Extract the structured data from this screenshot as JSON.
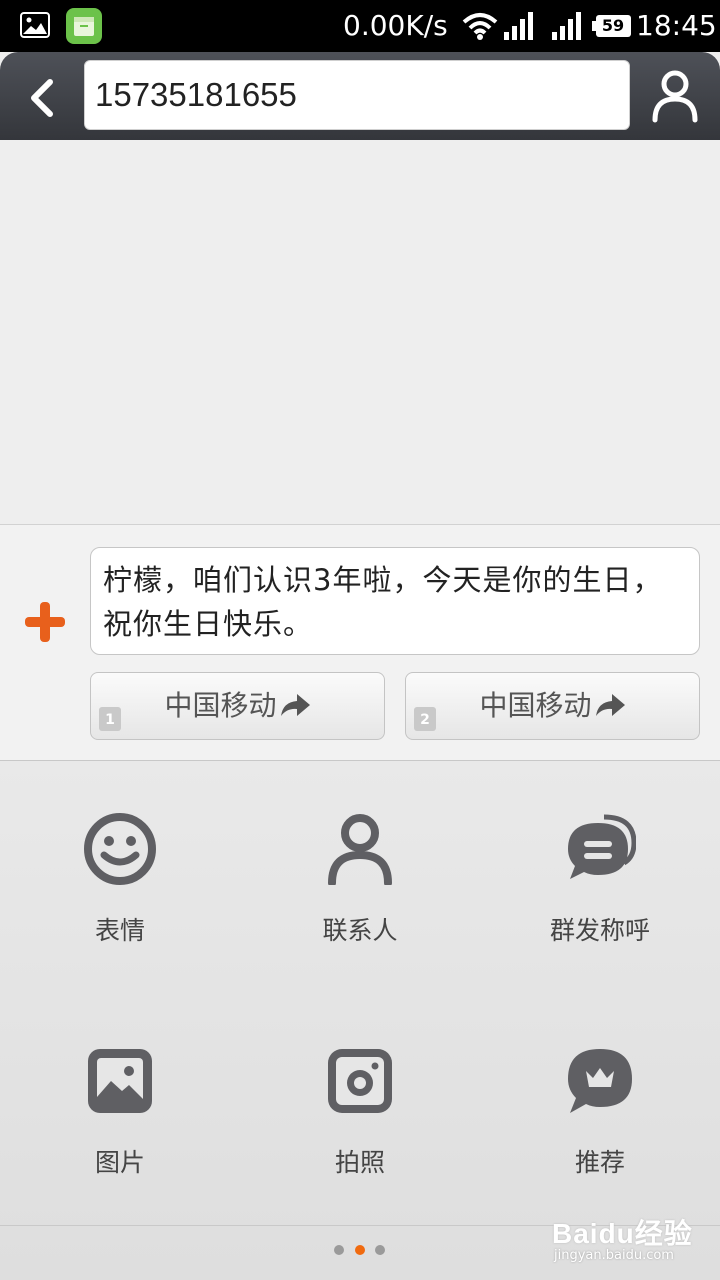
{
  "status_bar": {
    "network_speed": "0.00K/s",
    "battery_level": "59",
    "time": "18:45"
  },
  "header": {
    "recipient": "15735181655",
    "icons": {
      "back": "chevron-left-icon",
      "contact": "person-icon"
    }
  },
  "compose": {
    "message_text": "柠檬，咱们认识3年啦，今天是你的生日，祝你生日快乐。",
    "send_buttons": [
      {
        "sim": "1",
        "label": "中国移动"
      },
      {
        "sim": "2",
        "label": "中国移动"
      }
    ],
    "accent_color": "#e8601c"
  },
  "attach_panel": {
    "tools": [
      {
        "label": "表情",
        "icon": "smiley-icon"
      },
      {
        "label": "联系人",
        "icon": "contact-icon"
      },
      {
        "label": "群发称呼",
        "icon": "chat-bubbles-icon"
      },
      {
        "label": "图片",
        "icon": "image-icon"
      },
      {
        "label": "拍照",
        "icon": "camera-icon"
      },
      {
        "label": "推荐",
        "icon": "crown-bubble-icon"
      }
    ],
    "pages": 3,
    "current_page": 2
  },
  "watermark": {
    "text": "Baidu经验",
    "url": "jingyan.baidu.com"
  }
}
